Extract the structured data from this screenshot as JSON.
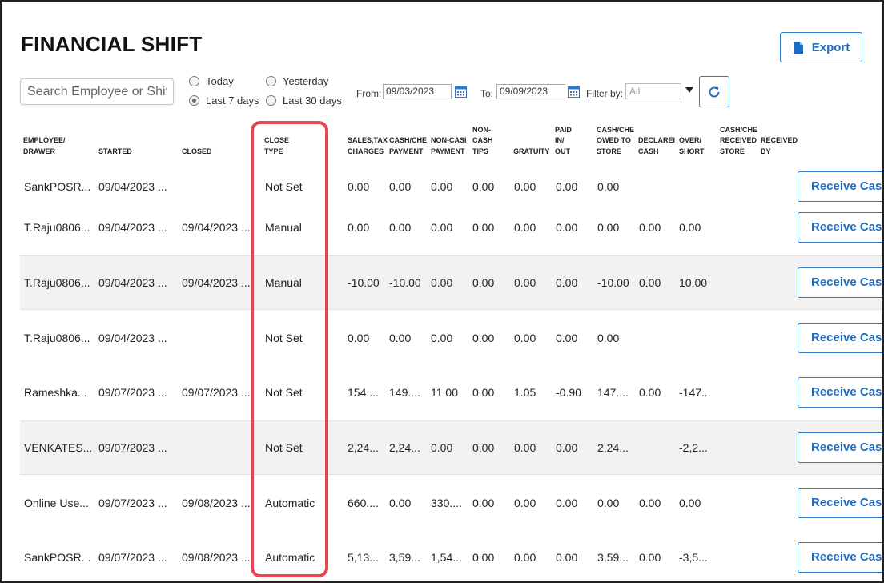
{
  "page": {
    "title": "FINANCIAL SHIFT",
    "export_label": "Export"
  },
  "filters": {
    "search_placeholder": "Search Employee or Shift",
    "radios": [
      {
        "label": "Today",
        "checked": false
      },
      {
        "label": "Last 7 days",
        "checked": true
      },
      {
        "label": "Yesterday",
        "checked": false
      },
      {
        "label": "Last 30 days",
        "checked": false
      }
    ],
    "from_label": "From:",
    "from_value": "09/03/2023",
    "to_label": "To:",
    "to_value": "09/09/2023",
    "filter_label": "Filter by:",
    "filter_value": "All"
  },
  "columns": [
    [
      "EMPLOYEE/",
      "DRAWER"
    ],
    [
      "STARTED"
    ],
    [
      "CLOSED"
    ],
    [
      "CLOSE",
      "TYPE"
    ],
    [
      "SALES,TAX",
      "CHARGES"
    ],
    [
      "CASH/CHE",
      "PAYMENT"
    ],
    [
      "NON-CASI",
      "PAYMENT"
    ],
    [
      "NON-",
      "CASH",
      "TIPS"
    ],
    [
      "GRATUITY"
    ],
    [
      "PAID",
      "IN/",
      "OUT"
    ],
    [
      "CASH/CHE",
      "OWED TO",
      "STORE"
    ],
    [
      "DECLAREI",
      "CASH"
    ],
    [
      "OVER/",
      "SHORT"
    ],
    [
      "CASH/CHE",
      "RECEIVED",
      "STORE"
    ],
    [
      "RECEIVED",
      "BY"
    ]
  ],
  "rows": [
    {
      "employee": "SankPOSR...",
      "started": "09/04/2023 ...",
      "closed": "",
      "close_type": "Not Set",
      "sales": "0.00",
      "cash_payment": "0.00",
      "noncash_payment": "0.00",
      "noncash_tips": "0.00",
      "gratuity": "0.00",
      "paid_inout": "0.00",
      "cash_owed": "0.00",
      "declared": "",
      "over_short": ""
    },
    {
      "employee": "T.Raju0806...",
      "started": "09/04/2023 ...",
      "closed": "09/04/2023 ...",
      "close_type": "Manual",
      "sales": "0.00",
      "cash_payment": "0.00",
      "noncash_payment": "0.00",
      "noncash_tips": "0.00",
      "gratuity": "0.00",
      "paid_inout": "0.00",
      "cash_owed": "0.00",
      "declared": "0.00",
      "over_short": "0.00"
    },
    {
      "employee": "T.Raju0806...",
      "started": "09/04/2023 ...",
      "closed": "09/04/2023 ...",
      "close_type": "Manual",
      "sales": "-10.00",
      "cash_payment": "-10.00",
      "noncash_payment": "0.00",
      "noncash_tips": "0.00",
      "gratuity": "0.00",
      "paid_inout": "0.00",
      "cash_owed": "-10.00",
      "declared": "0.00",
      "over_short": "10.00"
    },
    {
      "employee": "T.Raju0806...",
      "started": "09/04/2023 ...",
      "closed": "",
      "close_type": "Not Set",
      "sales": "0.00",
      "cash_payment": "0.00",
      "noncash_payment": "0.00",
      "noncash_tips": "0.00",
      "gratuity": "0.00",
      "paid_inout": "0.00",
      "cash_owed": "0.00",
      "declared": "",
      "over_short": ""
    },
    {
      "employee": "Rameshka...",
      "started": "09/07/2023 ...",
      "closed": "09/07/2023 ...",
      "close_type": "Not Set",
      "sales": "154....",
      "cash_payment": "149....",
      "noncash_payment": "11.00",
      "noncash_tips": "0.00",
      "gratuity": "1.05",
      "paid_inout": "-0.90",
      "cash_owed": "147....",
      "declared": "0.00",
      "over_short": "-147..."
    },
    {
      "employee": "VENKATES...",
      "started": "09/07/2023 ...",
      "closed": "",
      "close_type": "Not Set",
      "sales": "2,24...",
      "cash_payment": "2,24...",
      "noncash_payment": "0.00",
      "noncash_tips": "0.00",
      "gratuity": "0.00",
      "paid_inout": "0.00",
      "cash_owed": "2,24...",
      "declared": "",
      "over_short": "-2,2..."
    },
    {
      "employee": "Online Use...",
      "started": "09/07/2023 ...",
      "closed": "09/08/2023 ...",
      "close_type": "Automatic",
      "sales": "660....",
      "cash_payment": "0.00",
      "noncash_payment": "330....",
      "noncash_tips": "0.00",
      "gratuity": "0.00",
      "paid_inout": "0.00",
      "cash_owed": "0.00",
      "declared": "0.00",
      "over_short": "0.00"
    },
    {
      "employee": "SankPOSR...",
      "started": "09/07/2023 ...",
      "closed": "09/08/2023 ...",
      "close_type": "Automatic",
      "sales": "5,13...",
      "cash_payment": "3,59...",
      "noncash_payment": "1,54...",
      "noncash_tips": "0.00",
      "gratuity": "0.00",
      "paid_inout": "0.00",
      "cash_owed": "3,59...",
      "declared": "0.00",
      "over_short": "-3,5..."
    }
  ],
  "receive_label": "Receive Cash",
  "colors": {
    "accent": "#1f6bbd",
    "highlight": "#e8474f",
    "shade": "#f2f2f2"
  }
}
